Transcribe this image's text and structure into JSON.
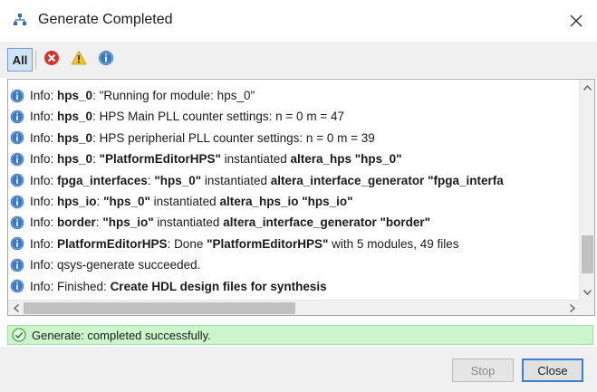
{
  "window": {
    "title": "Generate Completed"
  },
  "toolbar": {
    "all_label": "All"
  },
  "log": {
    "rows": [
      {
        "prefix": "Info: ",
        "module": "hps_0",
        "text": ": \"Running for module: hps_0\""
      },
      {
        "prefix": "Info: ",
        "module": "hps_0",
        "text": ": HPS Main PLL counter settings: n = 0 m = 47"
      },
      {
        "prefix": "Info: ",
        "module": "hps_0",
        "text": ": HPS peripherial PLL counter settings: n = 0 m = 39"
      },
      {
        "prefix": "Info: ",
        "module": "hps_0",
        "bold2": "\"PlatformEditorHPS\"",
        "mid": " instantiated ",
        "bold3": "altera_hps \"hps_0\"",
        "sep": ": "
      },
      {
        "prefix": "Info: ",
        "module": "fpga_interfaces",
        "bold2": "\"hps_0\"",
        "mid": " instantiated ",
        "bold3": "altera_interface_generator \"fpga_interfa",
        "sep": ": "
      },
      {
        "prefix": "Info: ",
        "module": "hps_io",
        "bold2": "\"hps_0\"",
        "mid": " instantiated ",
        "bold3": "altera_hps_io \"hps_io\"",
        "sep": ": "
      },
      {
        "prefix": "Info: ",
        "module": "border",
        "bold2": "\"hps_io\"",
        "mid": " instantiated ",
        "bold3": "altera_interface_generator \"border\"",
        "sep": ": "
      },
      {
        "prefix": "Info: ",
        "module": "PlatformEditorHPS",
        "sep": ": ",
        "mid": "Done ",
        "bold2": "\"PlatformEditorHPS\"",
        "tail": " with 5 modules, 49 files"
      },
      {
        "prefix": "Info: ",
        "plain": "qsys-generate succeeded."
      },
      {
        "prefix": "Info: ",
        "plain": "Finished: ",
        "bold2": "Create HDL design files for synthesis"
      }
    ]
  },
  "status": {
    "text": "Generate: completed successfully."
  },
  "buttons": {
    "stop": "Stop",
    "close": "Close"
  },
  "colors": {
    "status_bg": "#ccf5cc",
    "info_icon": "#3a78c3",
    "error_icon": "#d9322b",
    "warning_icon": "#f2c12e"
  }
}
